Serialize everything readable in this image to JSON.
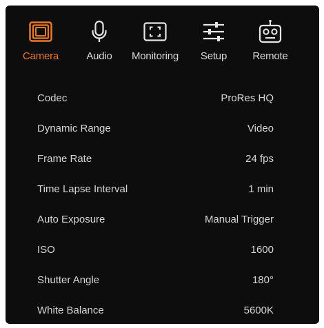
{
  "tabs": [
    {
      "label": "Camera",
      "icon": "camera-icon",
      "active": true
    },
    {
      "label": "Audio",
      "icon": "microphone-icon",
      "active": false
    },
    {
      "label": "Monitoring",
      "icon": "monitoring-frame-icon",
      "active": false
    },
    {
      "label": "Setup",
      "icon": "sliders-icon",
      "active": false
    },
    {
      "label": "Remote",
      "icon": "robot-remote-icon",
      "active": false
    }
  ],
  "settings": [
    {
      "label": "Codec",
      "value": "ProRes HQ"
    },
    {
      "label": "Dynamic Range",
      "value": "Video"
    },
    {
      "label": "Frame Rate",
      "value": "24 fps"
    },
    {
      "label": "Time Lapse Interval",
      "value": "1 min"
    },
    {
      "label": "Auto Exposure",
      "value": "Manual Trigger"
    },
    {
      "label": "ISO",
      "value": "1600"
    },
    {
      "label": "Shutter Angle",
      "value": "180°"
    },
    {
      "label": "White Balance",
      "value": "5600K"
    }
  ],
  "colors": {
    "background": "#0d0d0d",
    "accent": "#e8792a",
    "text": "#d8d8d8"
  }
}
